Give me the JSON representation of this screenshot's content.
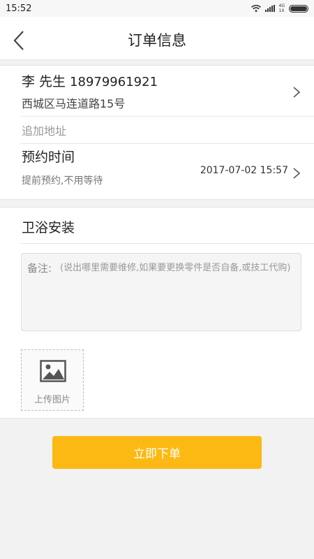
{
  "status_bar": {
    "time": "15:52",
    "network_top": "4G",
    "network_bottom": "1X"
  },
  "header": {
    "title": "订单信息"
  },
  "contact": {
    "name": "李  先生",
    "phone": "18979961921",
    "address": "西城区马连道路15号"
  },
  "add_address": "追加地址",
  "appointment": {
    "label": "预约时间",
    "subtitle": "提前预约,不用等待",
    "value": "2017-07-02 15:57"
  },
  "service": {
    "name": "卫浴安装"
  },
  "notes": {
    "label": "备注:",
    "placeholder": "(说出哪里需要维修,如果要更换零件是否自备,或技工代购)"
  },
  "upload": {
    "label": "上传图片"
  },
  "submit": {
    "label": "立即下单"
  },
  "colors": {
    "accent": "#fdb913",
    "background": "#f2f2f2"
  }
}
